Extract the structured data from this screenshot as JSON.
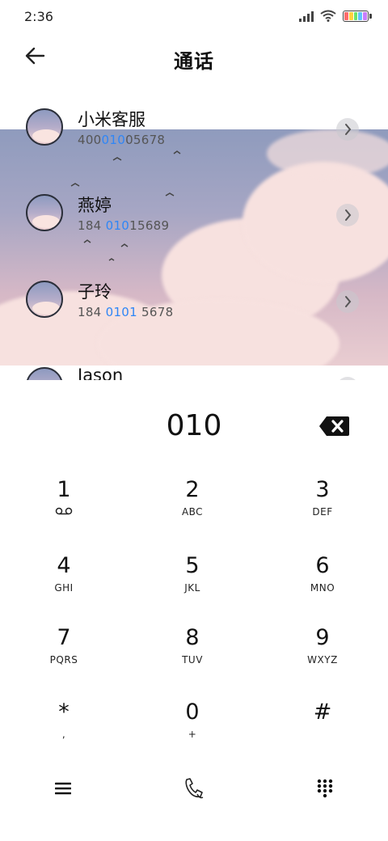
{
  "status_bar": {
    "time": "2:36",
    "battery_colors": [
      "#ff6b6b",
      "#ffd23f",
      "#6be36b",
      "#5fc3ff",
      "#c77dff"
    ]
  },
  "header": {
    "title": "通话",
    "back_icon": "arrow-left-icon"
  },
  "contacts": [
    {
      "name": "小米客服",
      "number_pre": "400",
      "number_hl": "010",
      "number_post": "05678"
    },
    {
      "name": "燕婷",
      "number_pre": "184 ",
      "number_hl": "010",
      "number_post": "15689"
    },
    {
      "name": "子玲",
      "number_pre": "184 ",
      "number_hl": "0101",
      "number_post": " 5678"
    },
    {
      "name": "Jason",
      "number_pre": "",
      "number_hl": "",
      "number_post": ""
    }
  ],
  "dialer": {
    "value": "010",
    "delete_icon": "backspace-icon"
  },
  "keypad": {
    "keys": [
      {
        "digit": "1",
        "letters": ""
      },
      {
        "digit": "2",
        "letters": "ABC"
      },
      {
        "digit": "3",
        "letters": "DEF"
      },
      {
        "digit": "4",
        "letters": "GHI"
      },
      {
        "digit": "5",
        "letters": "JKL"
      },
      {
        "digit": "6",
        "letters": "MNO"
      },
      {
        "digit": "7",
        "letters": "PQRS"
      },
      {
        "digit": "8",
        "letters": "TUV"
      },
      {
        "digit": "9",
        "letters": "WXYZ"
      },
      {
        "digit": "*",
        "letters": ","
      },
      {
        "digit": "0",
        "letters": "+"
      },
      {
        "digit": "#",
        "letters": ""
      }
    ]
  },
  "bottom_bar": {
    "menu_icon": "menu-icon",
    "call_icon": "phone-call-icon",
    "keypad_icon": "dialpad-icon"
  },
  "colors": {
    "highlight": "#2f86f6",
    "text": "#111111"
  }
}
